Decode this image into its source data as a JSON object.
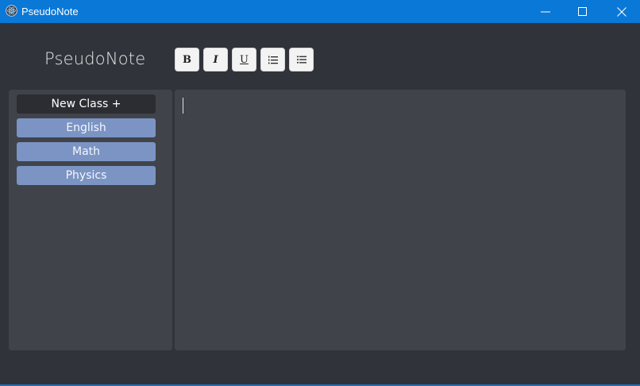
{
  "window": {
    "title": "PseudoNote",
    "controls": [
      "minimize-icon",
      "maximize-icon",
      "close-icon"
    ],
    "accent": "#0a78d7"
  },
  "header": {
    "brand": "PseudoNote",
    "toolbar": {
      "bold_label": "B",
      "italic_label": "I",
      "underline_label": "U",
      "numbered_list_icon": "numbered-list-icon",
      "bulleted_list_icon": "bulleted-list-icon"
    }
  },
  "sidebar": {
    "new_class_label": "New Class +",
    "classes": [
      "English",
      "Math",
      "Physics"
    ],
    "class_color": "#7b94c4"
  },
  "editor": {
    "content": ""
  }
}
